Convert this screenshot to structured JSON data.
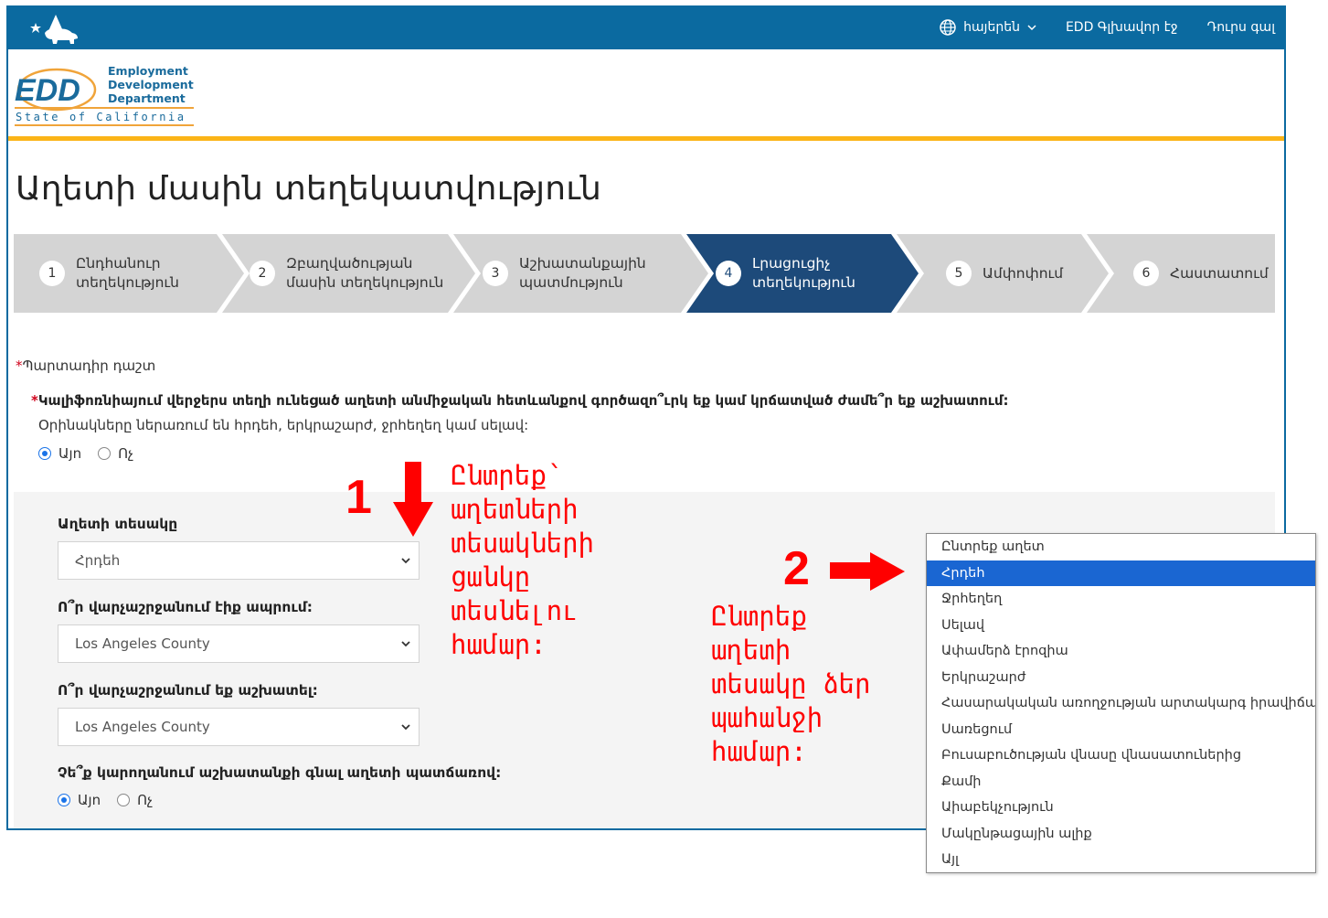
{
  "header": {
    "state_logo": "CA",
    "language_icon": "globe-icon",
    "language_label": "հայերեն",
    "home_link": "EDD Գլխավոր էջ",
    "logout_link": "Դուրս գալ"
  },
  "brand": {
    "acronym": "EDD",
    "line1": "Employment",
    "line2": "Development",
    "line3": "Department",
    "line4": "State of California"
  },
  "page_title": "Աղետի մասին տեղեկատվություն",
  "stepper": {
    "active_step": 4,
    "steps": [
      {
        "number": "1",
        "label": "Ընդհանուր\nտեղեկություն"
      },
      {
        "number": "2",
        "label": "Զբաղվածության\nմասին տեղեկություն"
      },
      {
        "number": "3",
        "label": "Աշխատանքային\nպատմություն"
      },
      {
        "number": "4",
        "label": "Լրացուցիչ\nտեղեկություն"
      },
      {
        "number": "5",
        "label": "Ամփոփում"
      },
      {
        "number": "6",
        "label": "Հաստատում"
      }
    ]
  },
  "form": {
    "required_note": "Պարտադիր դաշտ",
    "question1": "Կալիֆոռնիայում վերջերս տեղի ունեցած աղետի անմիջական հետևանքով գործազո՞ւրկ եք կամ կրճատված ժամե՞ր եք աշխատում:",
    "question1_hint": "Օրինակները ներառում են հրդեհ, երկրաշարժ, ջրհեղեղ կամ սելավ:",
    "question1_options": [
      "Այո",
      "Ոչ"
    ],
    "question1_selected": "Այո",
    "disaster_type_label": "Աղետի տեսակը",
    "disaster_type_value": "Հրդեհ",
    "county_lived_label": "Ո՞ր վարչաշրջանում էիք ապրում:",
    "county_lived_value": "Los Angeles County",
    "county_worked_label": "Ո՞ր վարչաշրջանում եք աշխատել:",
    "county_worked_value": "Los Angeles County",
    "question_unable_label": "Չե՞ք կարողանում աշխատանքի գնալ աղետի պատճառով:",
    "question_unable_options": [
      "Այո",
      "Ոչ"
    ],
    "question_unable_selected": "Այո"
  },
  "annotations": {
    "step1_number": "1",
    "step1_text": "Ընտրեք՝\nաղետների\nտեսակների\nցանկը\nտեսնելու\nհամար:",
    "step2_number": "2",
    "step2_text": "Ընտրեք\nաղետի\nտեսակը ձեր\nպահանջի\nհամար:",
    "color": "#ff0000"
  },
  "dropdown": {
    "selected": "Հրդեհ",
    "options": [
      "Ընտրեք աղետ",
      "Հրդեհ",
      "Ջրհեղեղ",
      "Սելավ",
      "Ափամերձ էրոզիա",
      "Երկրաշարժ",
      "Հասարակական առողջության արտակարգ իրավիճակ",
      "Սառեցում",
      "Բուսաբուծության վնասը վնասատուներից",
      "Քամի",
      "Աիաբեկչություն",
      "Մակընթացային ալիք",
      "Այլ"
    ]
  },
  "colors": {
    "header_blue": "#0b6aa0",
    "gold": "#fbb417",
    "step_active": "#1d4a7a",
    "step_inactive": "#d4d4d4",
    "selected_option": "#1a66d2"
  }
}
